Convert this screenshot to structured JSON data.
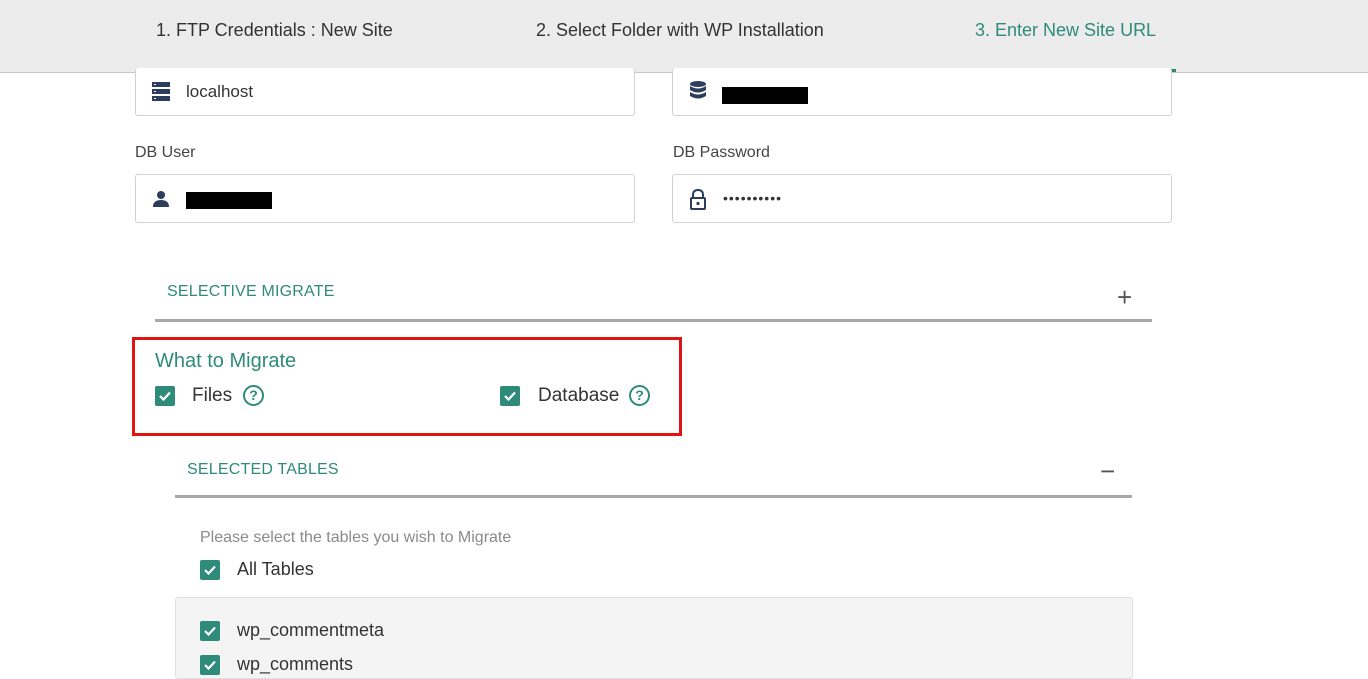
{
  "tabs": [
    {
      "label": "1. FTP Credentials : New Site"
    },
    {
      "label": "2. Select Folder with WP Installation"
    },
    {
      "label": "3. Enter New Site URL"
    }
  ],
  "db": {
    "host_value": "localhost",
    "user_label": "DB User",
    "password_label": "DB Password",
    "password_value": "••••••••••"
  },
  "selective_migrate": {
    "title": "SELECTIVE MIGRATE",
    "toggle": "+"
  },
  "what_to_migrate": {
    "title": "What to Migrate",
    "files_label": "Files",
    "database_label": "Database",
    "help_glyph": "?"
  },
  "selected_tables": {
    "title": "SELECTED TABLES",
    "toggle": "−",
    "hint": "Please select the tables you wish to Migrate",
    "all_label": "All Tables",
    "items": [
      "wp_commentmeta",
      "wp_comments"
    ]
  },
  "colors": {
    "accent": "#2e8b7a",
    "highlight": "#e01414",
    "tab_bar": "#ececec"
  },
  "icons": [
    "server-icon",
    "database-icon",
    "user-icon",
    "lock-icon",
    "checkmark-icon",
    "help-icon"
  ]
}
